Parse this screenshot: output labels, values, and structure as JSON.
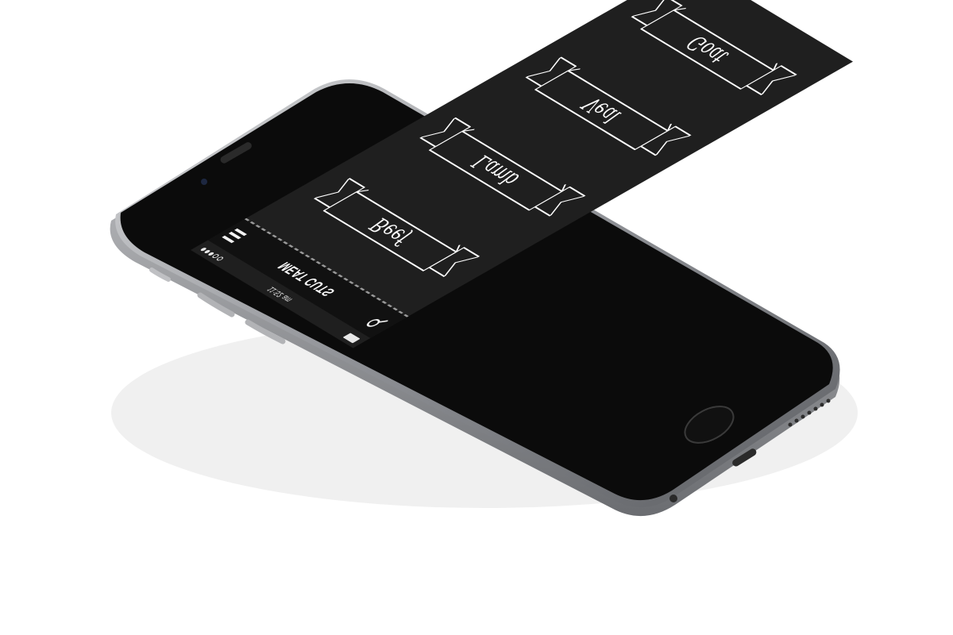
{
  "status_bar": {
    "time": "11:52 am"
  },
  "nav": {
    "title": "MEAT CUTS",
    "menu_icon": "hamburger-menu-icon",
    "search_icon": "search-icon"
  },
  "categories": [
    {
      "label": "Beef"
    },
    {
      "label": "Lamb"
    },
    {
      "label": "Veal"
    },
    {
      "label": "Goat"
    }
  ],
  "colors": {
    "screen_background": "#1f1f1f",
    "nav_background": "#111111",
    "ribbon_stroke": "#ffffff",
    "device_body": "#0b0b0b",
    "device_frame": "#9fa1a6"
  }
}
